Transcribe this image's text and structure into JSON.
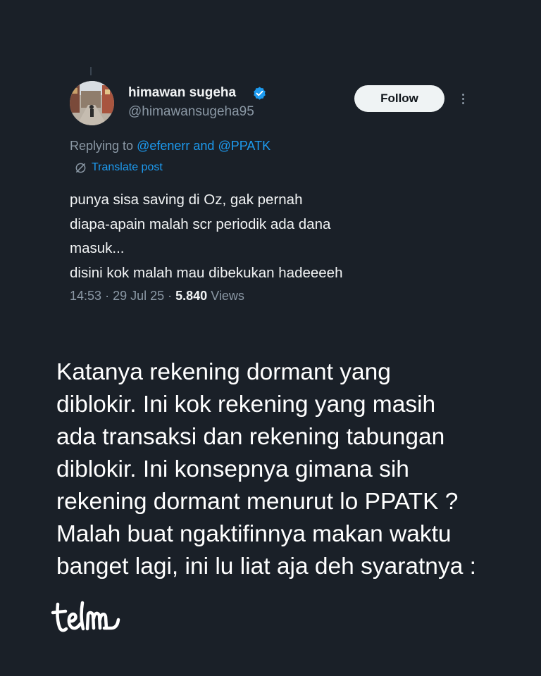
{
  "tweet": {
    "author": {
      "name": "himawan sugeha",
      "handle": "@himawansugeha95",
      "verified_color": "#1d9bf0"
    },
    "follow_label": "Follow",
    "more_icon": "more-vertical-icon",
    "reply": {
      "prefix": "Replying to",
      "mention_1": "@efenerr",
      "conjunction": "and",
      "mention_2": "@PPATK"
    },
    "translate_label": "Translate post",
    "body_lines": [
      "punya sisa saving di Oz, gak pernah",
      "diapa-apain malah scr periodik ada dana",
      "masuk...",
      "disini kok malah mau dibekukan hadeeeeh"
    ],
    "time": "14:53",
    "date": "29 Jul 25",
    "views_count": "5.840",
    "views_label": "Views"
  },
  "caption_lines": [
    "Katanya rekening dormant yang",
    "diblokir. Ini kok rekening yang masih",
    "ada transaksi dan rekening tabungan",
    "diblokir. Ini konsepnya gimana sih",
    "rekening dormant menurut lo PPATK ?",
    "Malah buat ngaktifinnya makan waktu",
    "banget lagi, ini lu liat aja deh syaratnya :"
  ],
  "brand": {
    "logo_text": "telm"
  },
  "colors": {
    "background": "#1a2028",
    "accent": "#1d9bf0",
    "muted": "#8b98a5"
  }
}
